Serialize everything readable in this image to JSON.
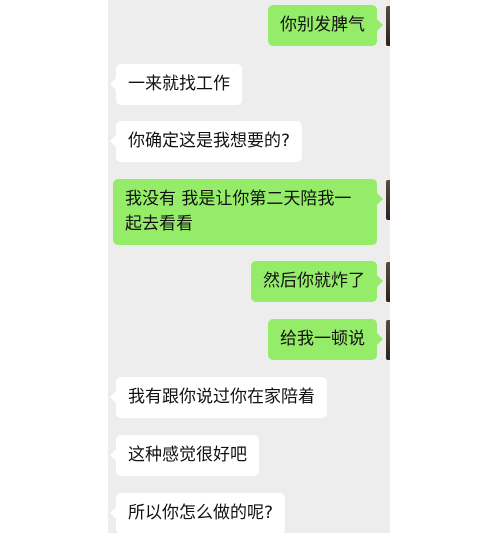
{
  "messages": [
    {
      "side": "out",
      "text": "你别发脾气"
    },
    {
      "side": "in",
      "text": "一来就找工作"
    },
    {
      "side": "in",
      "text": "你确定这是我想要的?"
    },
    {
      "side": "out",
      "text": "我没有 我是让你第二天陪我一起去看看"
    },
    {
      "side": "out",
      "text": "然后你就炸了"
    },
    {
      "side": "out",
      "text": "给我一顿说"
    },
    {
      "side": "in",
      "text": "我有跟你说过你在家陪着"
    },
    {
      "side": "in",
      "text": "这种感觉很好吧"
    },
    {
      "side": "in",
      "text": "所以你怎么做的呢?"
    }
  ]
}
